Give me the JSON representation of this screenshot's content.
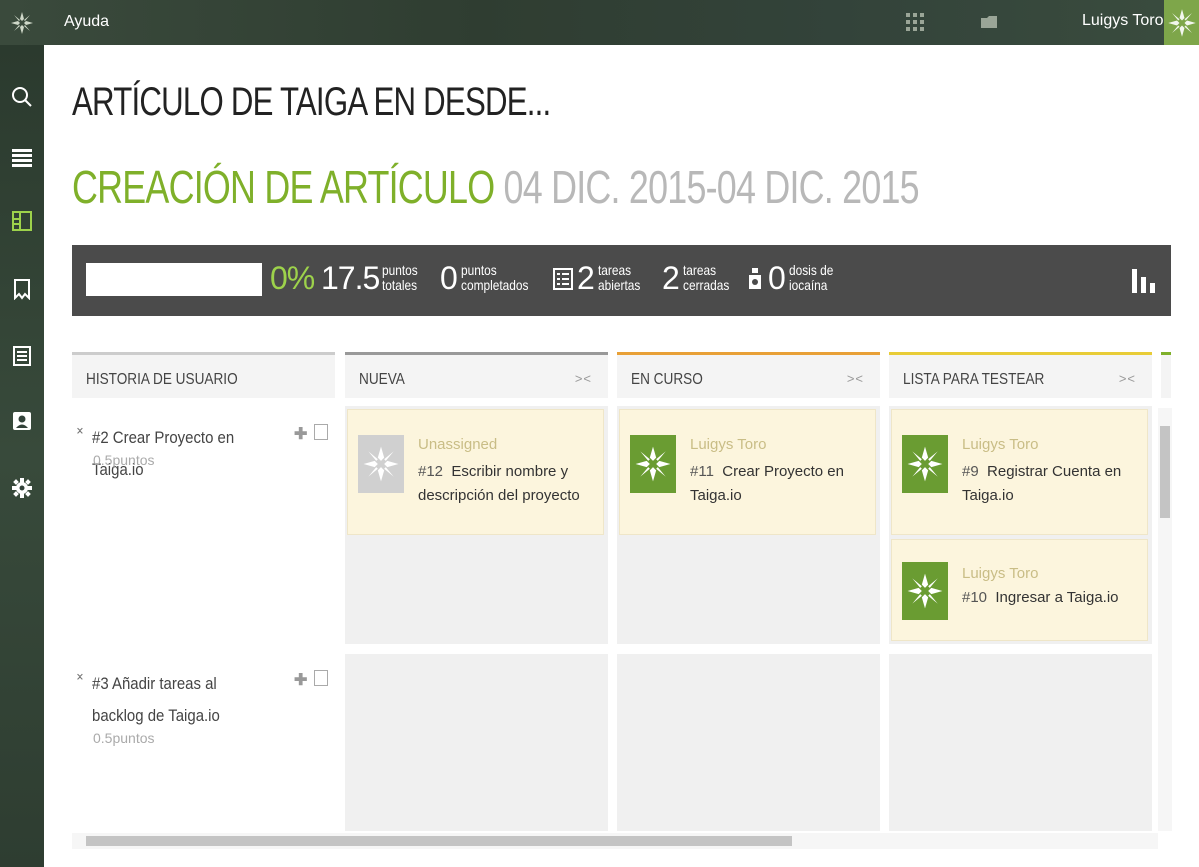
{
  "topbar": {
    "help_label": "Ayuda",
    "username": "Luigys Toro",
    "icons": [
      "taiga-logo-icon",
      "grid-icon",
      "folder-icon"
    ]
  },
  "sidebar": {
    "items": [
      {
        "icon": "search-icon"
      },
      {
        "icon": "backlog-icon"
      },
      {
        "icon": "kanban-icon",
        "active": true
      },
      {
        "icon": "issues-icon"
      },
      {
        "icon": "wiki-icon"
      },
      {
        "icon": "team-icon"
      },
      {
        "icon": "settings-icon"
      }
    ]
  },
  "page": {
    "title": "ARTÍCULO DE TAIGA EN DESDE...",
    "sprint_name": "CREACIÓN DE ARTÍCULO",
    "sprint_dates": "04 DIC. 2015-04 DIC. 2015"
  },
  "stats": {
    "progress_pct": "0%",
    "total_points_value": "17.5",
    "total_points_label_1": "puntos",
    "total_points_label_2": "totales",
    "completed_points_value": "0",
    "completed_points_label_1": "puntos",
    "completed_points_label_2": "completados",
    "open_tasks_value": "2",
    "open_tasks_label_1": "tareas",
    "open_tasks_label_2": "abiertas",
    "closed_tasks_value": "2",
    "closed_tasks_label_1": "tareas",
    "closed_tasks_label_2": "cerradas",
    "iocaine_value": "0",
    "iocaine_label_1": "dosis de",
    "iocaine_label_2": "iocaína",
    "progress_fraction": 0
  },
  "board": {
    "user_story_header": "HISTORIA DE USUARIO",
    "fold_symbol": "><",
    "columns": [
      {
        "label": "NUEVA",
        "color": "#999999"
      },
      {
        "label": "EN CURSO",
        "color": "#e8a037"
      },
      {
        "label": "LISTA PARA TESTEAR",
        "color": "#e8cc37"
      }
    ],
    "user_stories": [
      {
        "title": "#2 Crear Proyecto en Taiga.io",
        "points": "0.5puntos"
      },
      {
        "title": "#3 Añadir tareas al backlog de Taiga.io",
        "points": "0.5puntos"
      }
    ],
    "cards": [
      {
        "owner": "Unassigned",
        "ref": "#12",
        "subject": "Escribir nombre y descripción del proyecto"
      },
      {
        "owner": "Luigys Toro",
        "ref": "#11",
        "subject": "Crear Proyecto en Taiga.io"
      },
      {
        "owner": "Luigys Toro",
        "ref": "#9",
        "subject": "Registrar Cuenta en Taiga.io"
      },
      {
        "owner": "Luigys Toro",
        "ref": "#10",
        "subject": "Ingresar a Taiga.io"
      }
    ]
  },
  "colors": {
    "accent_green": "#7fb02a",
    "progress_green": "#9dd24b",
    "card_bg": "#fcf5dd",
    "stats_bg": "#4b4b4b"
  }
}
